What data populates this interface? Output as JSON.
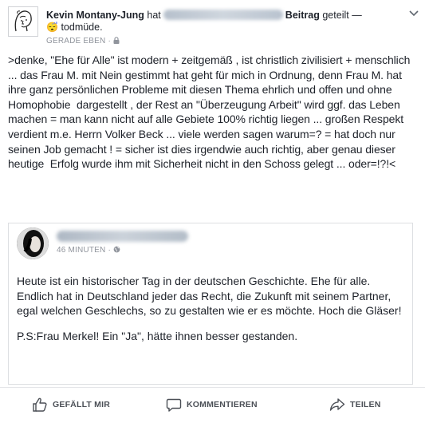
{
  "post": {
    "author": "Kevin Montany-Jung",
    "word_hat": "hat",
    "shared_post_label": "Beitrag",
    "shared_verb": "geteilt —",
    "feeling_emoji": "😴",
    "feeling_text": "todmüde.",
    "timestamp": "GERADE EBEN",
    "dot": "·",
    "text": ">denke, \"Ehe für Alle\" ist modern + zeitgemäß , ist christlich zivilisiert + menschlich ... das Frau M. mit Nein gestimmt hat geht für mich in Ordnung, denn Frau M. hat ihre ganz persönlichen Probleme mit diesen Thema ehrlich und offen und ohne Homophobie  dargestellt , der Rest an \"Überzeugung Arbeit\" wird ggf. das Leben machen = man kann nicht auf alle Gebiete 100% richtig liegen ... großen Respekt verdient m.e. Herrn Volker Beck ... viele werden sagen warum=? = hat doch nur seinen Job gemacht ! = sicher ist dies irgendwie auch richtig, aber genau dieser heutige  Erfolg wurde ihm mit Sicherheit nicht in den Schoss gelegt ... oder=!?!<"
  },
  "shared": {
    "timestamp": "46 MINUTEN",
    "dot": "·",
    "paragraph1": "Heute ist ein historischer Tag in der deutschen Geschichte. Ehe für alle.",
    "paragraph2": "Endlich hat in Deutschland jeder das Recht, die Zukunft mit seinem Partner, egal welchen Geschlechs, so zu gestalten wie er es möchte. Hoch die Gläser!",
    "paragraph3": "P.S:Frau Merkel! Ein \"Ja\", hätte ihnen besser gestanden."
  },
  "actions": {
    "like": "GEFÄLLT MIR",
    "comment": "KOMMENTIEREN",
    "share": "TEILEN"
  },
  "colors": {
    "text": "#1d2129",
    "meta": "#90949c",
    "action": "#4b4f56",
    "border": "#dddfe2"
  }
}
